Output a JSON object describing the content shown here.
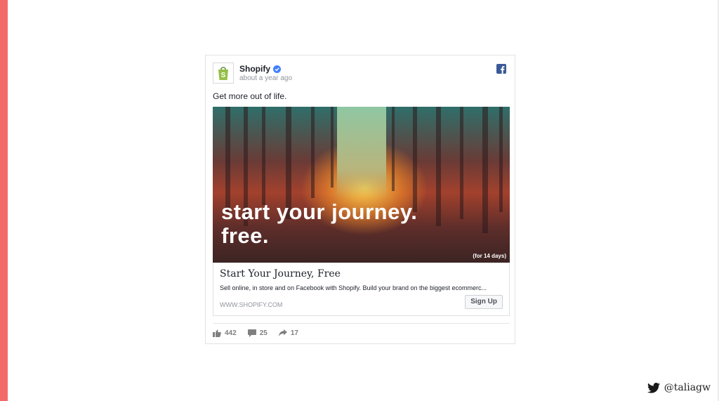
{
  "post": {
    "page_name": "Shopify",
    "timestamp": "about a year ago",
    "message": "Get more out of life.",
    "hero_line1": "start your journey.",
    "hero_line2": "free.",
    "hero_note": "(for 14 days)"
  },
  "link": {
    "title": "Start Your Journey, Free",
    "description": "Sell online, in store and on Facebook with Shopify. Build your brand on the biggest ecommerc...",
    "domain": "WWW.SHOPIFY.COM",
    "cta": "Sign Up"
  },
  "stats": {
    "likes": "442",
    "comments": "25",
    "shares": "17"
  },
  "footer": {
    "handle": "@taliagw"
  },
  "colors": {
    "accent_bar": "#f26a6a",
    "facebook_blue": "#3b5998",
    "shopify_green": "#95bf47",
    "verified": "#4080ff"
  },
  "icons": [
    "shopify-logo-icon",
    "verified-icon",
    "facebook-icon",
    "like-icon",
    "comment-icon",
    "share-icon",
    "twitter-bird-icon"
  ]
}
